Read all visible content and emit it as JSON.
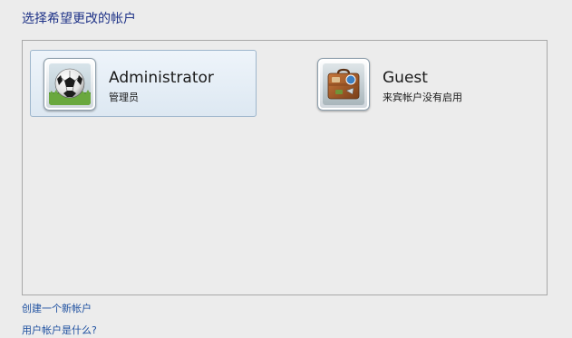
{
  "heading": "选择希望更改的帐户",
  "accounts": [
    {
      "name": "Administrator",
      "description": "管理员",
      "icon": "soccer-ball-icon",
      "selected": true
    },
    {
      "name": "Guest",
      "description": "来宾帐户没有启用",
      "icon": "briefcase-icon",
      "selected": false
    }
  ],
  "links": {
    "create_account": "创建一个新帐户",
    "what_is_account": "用户帐户是什么?"
  },
  "colors": {
    "heading": "#1e3287",
    "link": "#1e50a0",
    "selection_border": "#9eb6cc"
  }
}
